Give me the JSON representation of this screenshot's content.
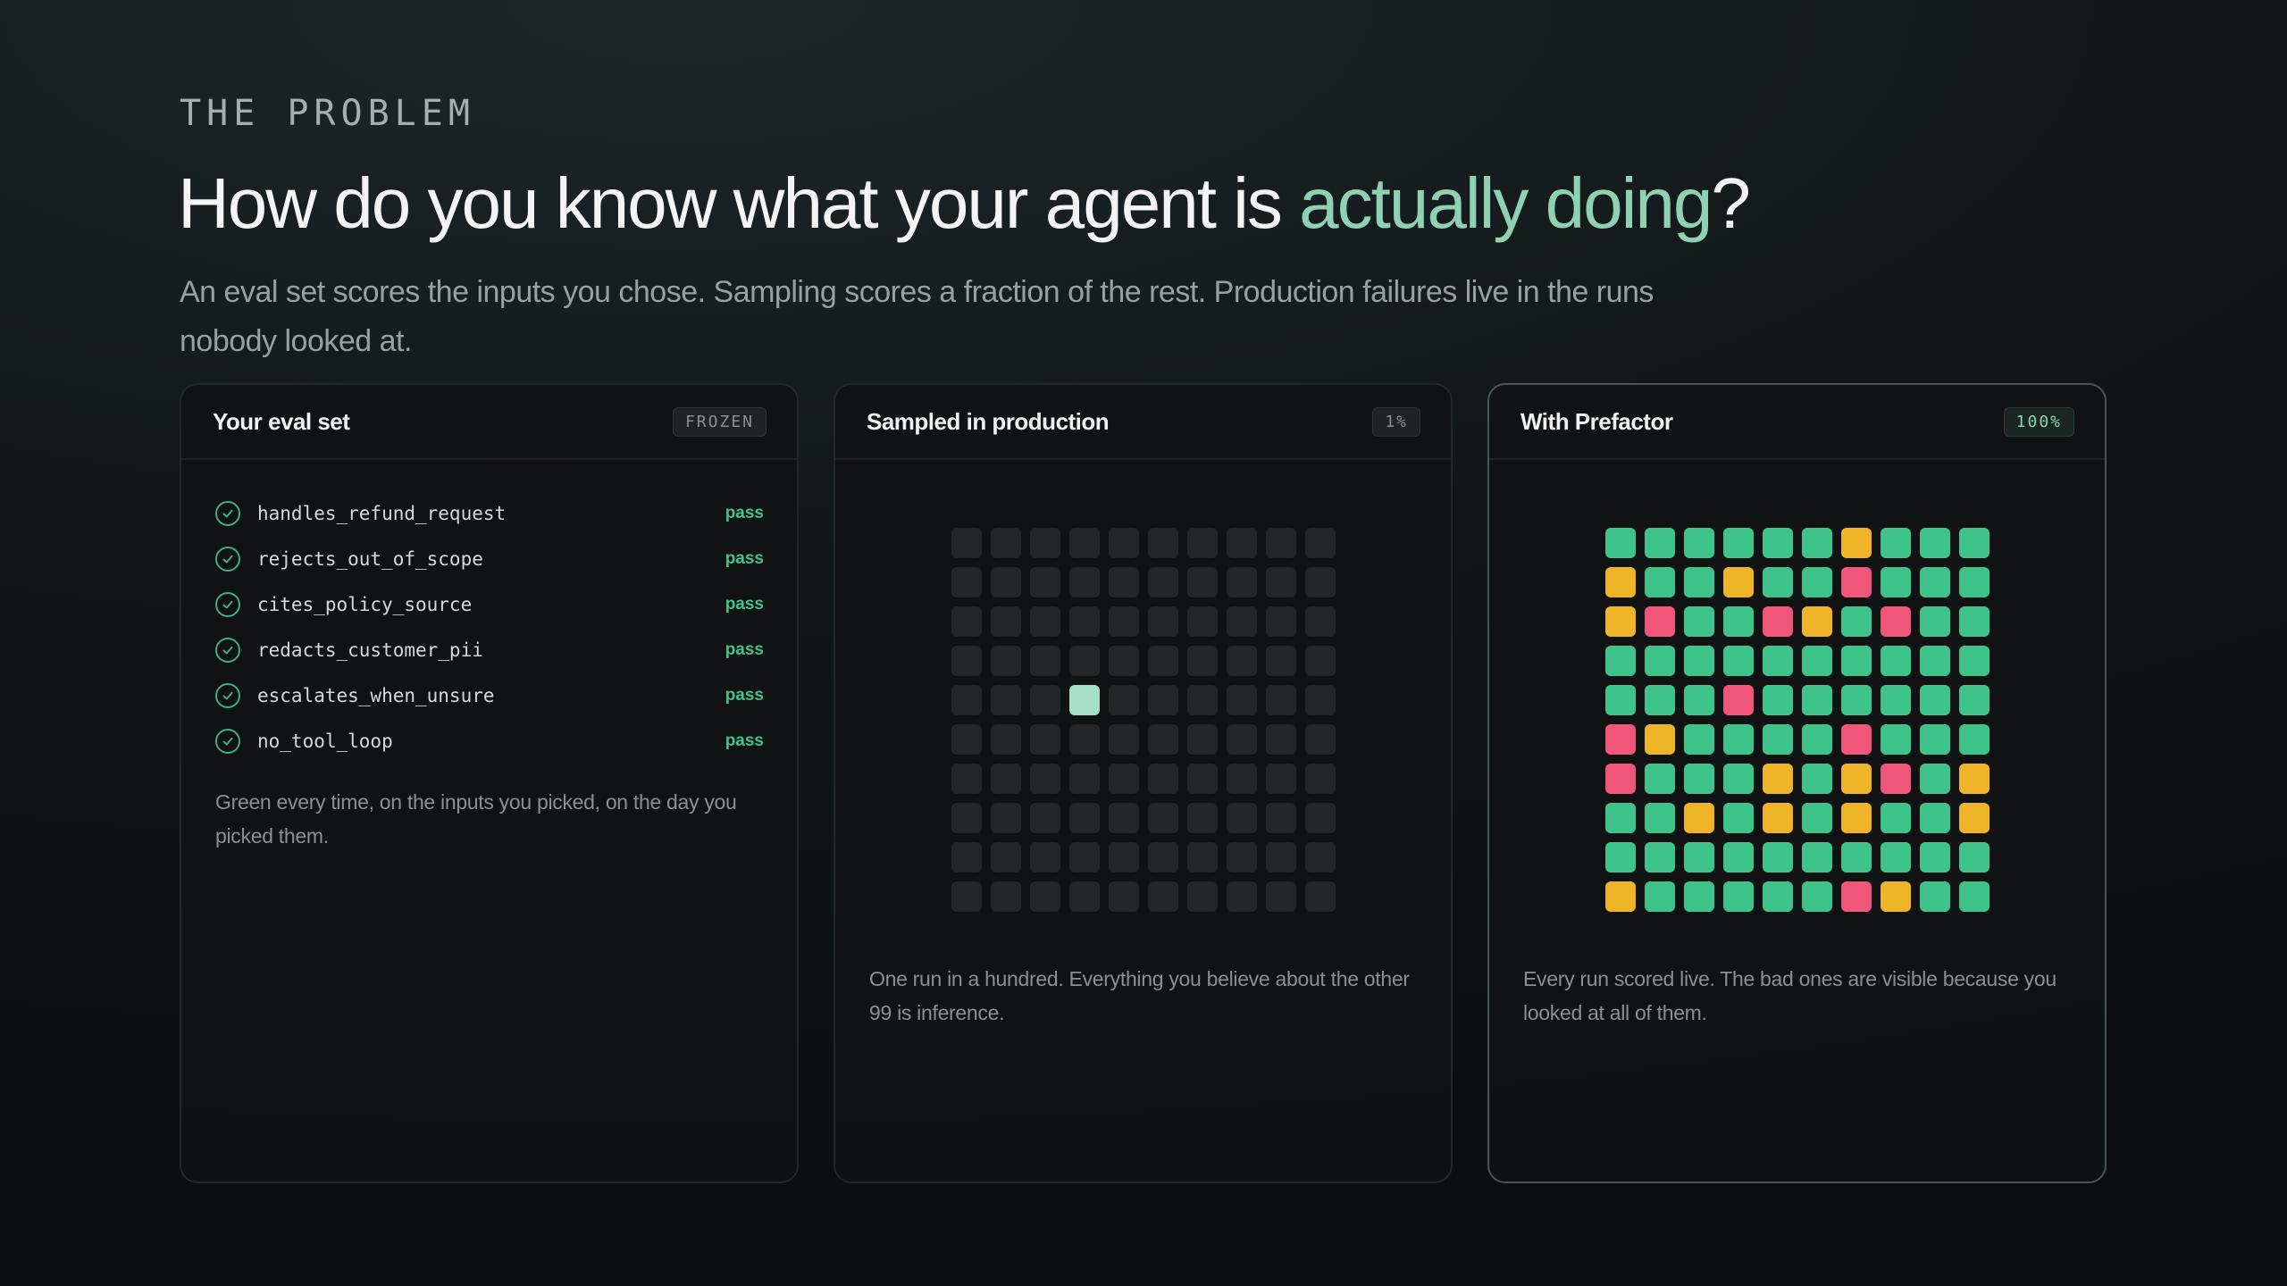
{
  "eyebrow": "THE PROBLEM",
  "headline": {
    "before": "How do you know what your agent is ",
    "accent": "actually doing",
    "after": "?"
  },
  "subhead": "An eval set scores the inputs you chose. Sampling scores a fraction of the rest. Production failures live in the runs nobody looked at.",
  "colors": {
    "pass": "#3ec48a",
    "warn": "#f0b429",
    "fail": "#f0557a",
    "empty": "#222627",
    "sampled": "#a6dfc8",
    "accent": "#8fd1b5"
  },
  "cards": {
    "eval": {
      "title": "Your eval set",
      "badge": "FROZEN",
      "items": [
        {
          "name": "handles_refund_request",
          "status": "pass"
        },
        {
          "name": "rejects_out_of_scope",
          "status": "pass"
        },
        {
          "name": "cites_policy_source",
          "status": "pass"
        },
        {
          "name": "redacts_customer_pii",
          "status": "pass"
        },
        {
          "name": "escalates_when_unsure",
          "status": "pass"
        },
        {
          "name": "no_tool_loop",
          "status": "pass"
        }
      ],
      "note": "Green every time, on the inputs you picked, on the day you picked them."
    },
    "sampled": {
      "title": "Sampled in production",
      "badge": "1%",
      "grid": [
        "..........",
        "..........",
        "..........",
        "..........",
        "...s......",
        "..........",
        "..........",
        "..........",
        "..........",
        ".........."
      ],
      "note": "One run in a hundred. Everything you believe about the other 99 is inference."
    },
    "prefactor": {
      "title": "With Prefactor",
      "badge": "100%",
      "grid": [
        "ggggggyggg",
        "yggyggfggg",
        "yfggfygfgg",
        "gggggggggg",
        "gggfgggggg",
        "fyggggfggg",
        "fgggygyfgy",
        "ggygygyggy",
        "gggggggggg",
        "ygggggfyggg"
      ],
      "note": "Every run scored live. The bad ones are visible because you looked at all of them."
    }
  }
}
